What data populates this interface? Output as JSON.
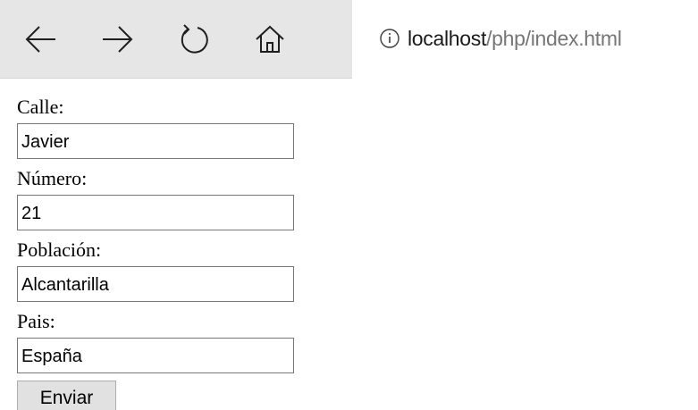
{
  "browser": {
    "url_host": "localhost",
    "url_path": "/php/index.html",
    "icons": {
      "back": "back-arrow-icon",
      "forward": "forward-arrow-icon",
      "refresh": "refresh-icon",
      "home": "home-icon",
      "info": "info-icon"
    }
  },
  "form": {
    "fields": [
      {
        "label": "Calle:",
        "value": "Javier"
      },
      {
        "label": "Número:",
        "value": "21"
      },
      {
        "label": "Población:",
        "value": "Alcantarilla"
      },
      {
        "label": "Pais:",
        "value": "España"
      }
    ],
    "submit_label": "Enviar"
  },
  "colors": {
    "toolbar_bg": "#e6e6e6",
    "url_path": "#767676",
    "input_border": "#767676",
    "button_bg": "#e1e1e1"
  }
}
